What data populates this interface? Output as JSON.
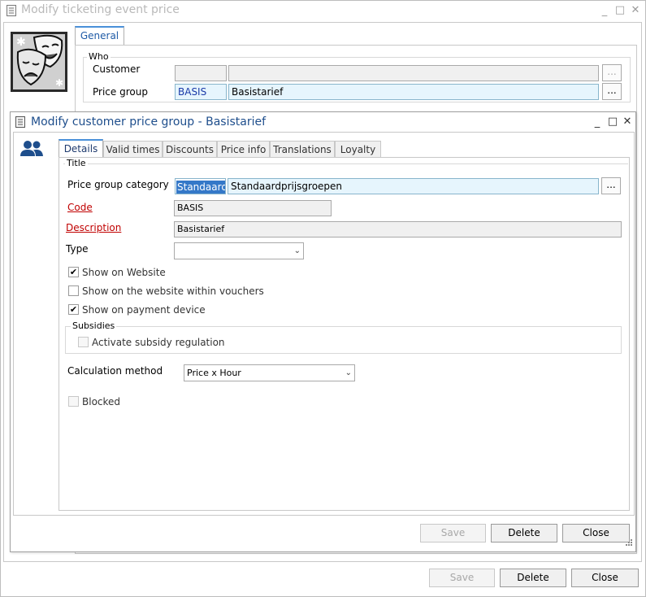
{
  "outer": {
    "title": "Modify ticketing event price",
    "tab_general": "General",
    "who_legend": "Who",
    "customer_label": "Customer",
    "customer_code": "",
    "customer_name": "",
    "pricegroup_label": "Price group",
    "pricegroup_code": "BASIS",
    "pricegroup_name": "Basistarief",
    "ellipsis": "...",
    "save": "Save",
    "delete": "Delete",
    "close": "Close"
  },
  "inner": {
    "title": "Modify customer price group - Basistarief",
    "tabs": [
      "Details",
      "Valid times",
      "Discounts",
      "Price info",
      "Translations",
      "Loyalty"
    ],
    "title_legend": "Title",
    "category_label": "Price group category",
    "category_code": "Standaard",
    "category_name": "Standaardprijsgroepen",
    "code_label": "Code",
    "code_value": "BASIS",
    "description_label": "Description",
    "description_value": "Basistarief",
    "type_label": "Type",
    "type_value": "",
    "show_website": "Show on Website",
    "show_website_vouchers": "Show on the website within vouchers",
    "show_payment": "Show on payment device",
    "subsidies_legend": "Subsidies",
    "activate_subsidy": "Activate subsidy regulation",
    "calc_label": "Calculation method",
    "calc_value": "Price x Hour",
    "blocked": "Blocked",
    "ellipsis": "...",
    "check": "✔",
    "save": "Save",
    "delete": "Delete",
    "close": "Close"
  }
}
